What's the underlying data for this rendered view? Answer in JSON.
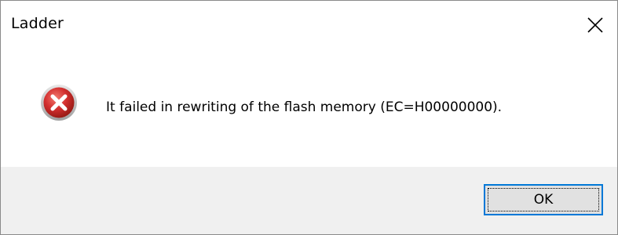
{
  "window": {
    "title": "Ladder",
    "close_icon": "close-icon"
  },
  "dialog": {
    "icon": "error-icon",
    "message": "It failed in rewriting of the flash memory (EC=H00000000).",
    "ok_label": "OK"
  },
  "colors": {
    "error_red": "#d32f2f",
    "focus_border": "#0078d7",
    "footer_bg": "#f0f0f0"
  }
}
